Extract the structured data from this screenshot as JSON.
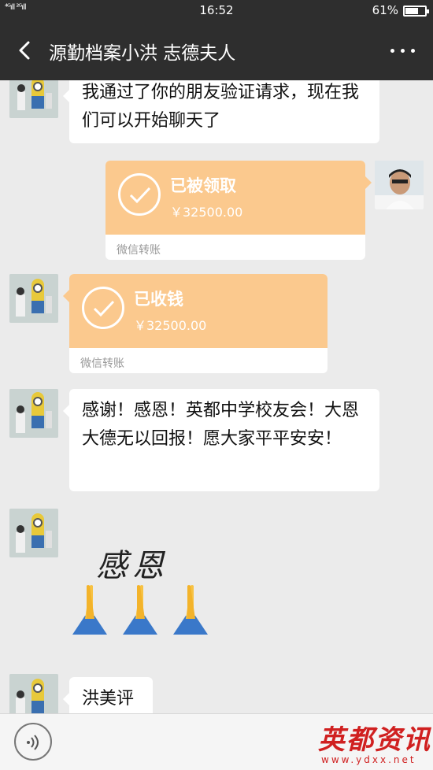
{
  "status_bar": {
    "signal_left": "⁴ᴳıll ²ᴳıll",
    "time": "16:52",
    "battery_pct": "61%"
  },
  "nav": {
    "title": "源勤档案小洪 志德夫人"
  },
  "messages": {
    "m1_text": "我通过了你的朋友验证请求，现在我们可以开始聊天了",
    "transfer_sent": {
      "title": "已被领取",
      "amount": "￥32500.00",
      "foot": "微信转账"
    },
    "transfer_received": {
      "title": "已收钱",
      "amount": "￥32500.00",
      "foot": "微信转账"
    },
    "m3_text": "感谢！感恩！英都中学校友会！大恩大德无以回报！愿大家平平安安！",
    "sticker_text": "感恩",
    "m5_text": "洪美评"
  },
  "watermark": {
    "text": "英都资讯",
    "url": "www.ydxx.net"
  },
  "colors": {
    "header_bg": "#2e2e2e",
    "chat_bg": "#ebebeb",
    "transfer_bg": "#fbc98e"
  }
}
